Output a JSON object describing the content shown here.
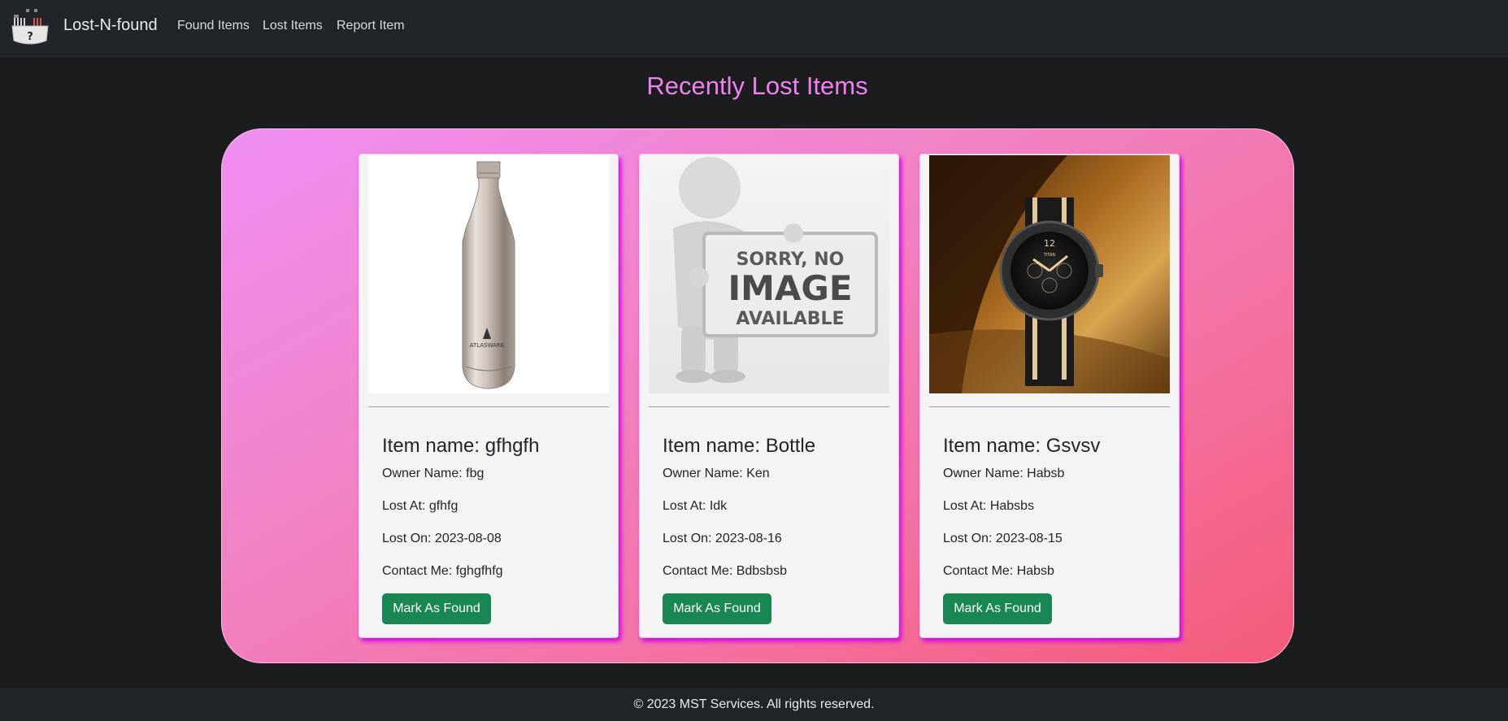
{
  "nav": {
    "brand": "Lost-N-found",
    "links": [
      "Found Items",
      "Lost Items",
      "Report Item"
    ]
  },
  "page": {
    "title": "Recently Lost Items"
  },
  "cards": [
    {
      "title": "Item name: gfhgfh",
      "owner": "Owner Name: fbg",
      "lost_at": "Lost At: gfhfg",
      "lost_on": "Lost On: 2023-08-08",
      "contact": "Contact Me: fghgfhfg",
      "button": "Mark As Found",
      "image": "steel-bottle-image",
      "image_text": "ATLASWARE"
    },
    {
      "title": "Item name: Bottle",
      "owner": "Owner Name: Ken",
      "lost_at": "Lost At: Idk",
      "lost_on": "Lost On: 2023-08-16",
      "contact": "Contact Me: Bdbsbsb",
      "button": "Mark As Found",
      "image": "no-image-placeholder",
      "image_text": [
        "SORRY, NO",
        "IMAGE",
        "AVAILABLE"
      ]
    },
    {
      "title": "Item name: Gsvsv",
      "owner": "Owner Name: Habsb",
      "lost_at": "Lost At: Habsbs",
      "lost_on": "Lost On: 2023-08-15",
      "contact": "Contact Me: Habsb",
      "button": "Mark As Found",
      "image": "wrist-watch-image",
      "image_text": "TITAN"
    }
  ],
  "footer": {
    "text": "© 2023 MST Services. All rights reserved."
  },
  "colors": {
    "title_accent": "#ee82ee",
    "button": "#198754",
    "navbar": "#212529"
  }
}
